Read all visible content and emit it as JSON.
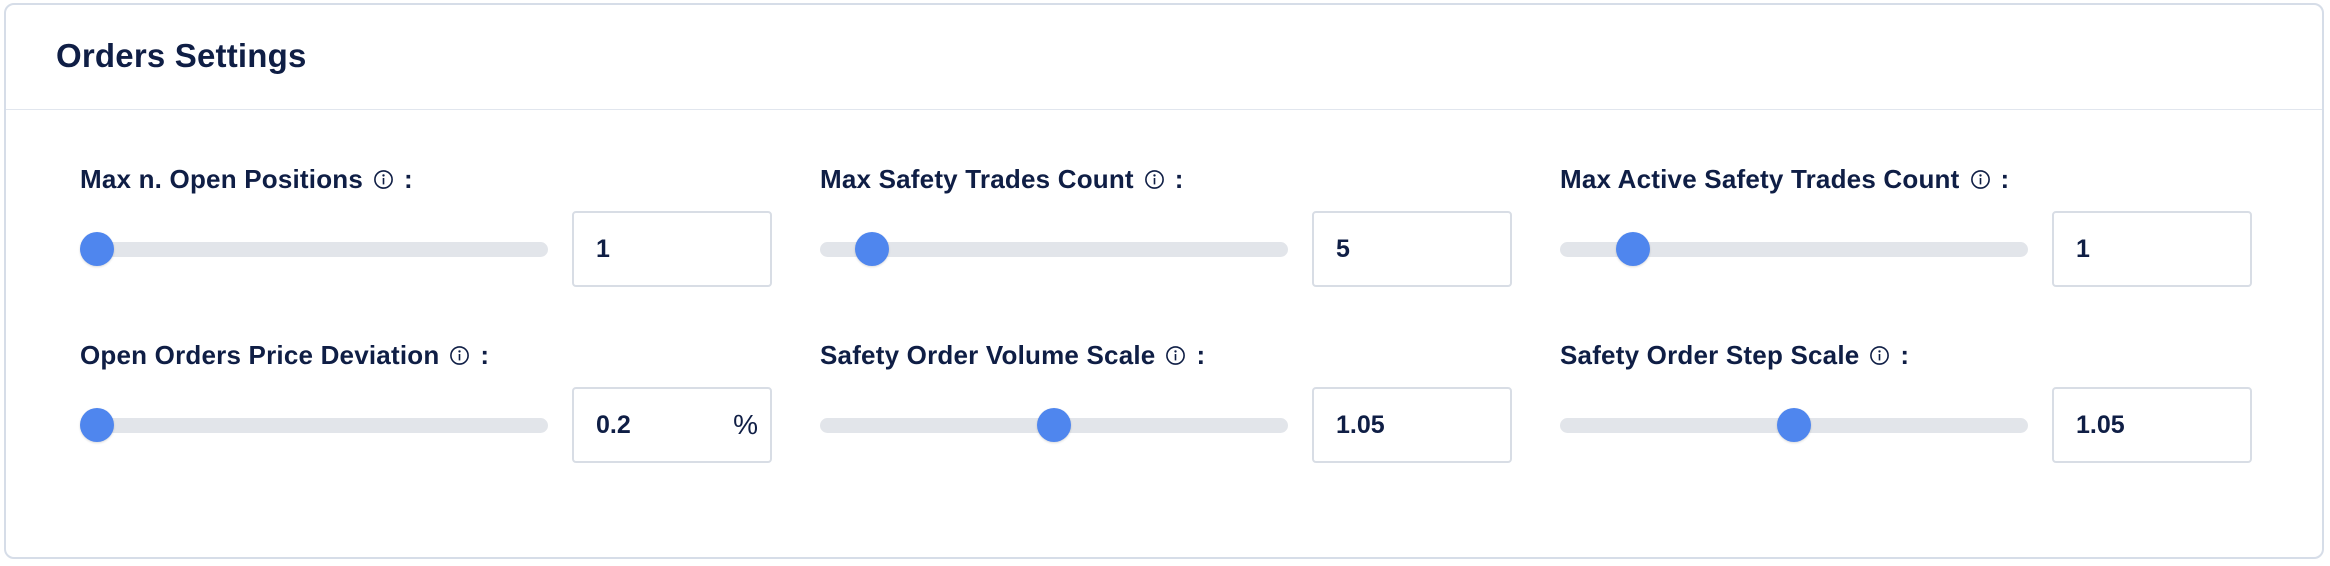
{
  "panel": {
    "title": "Orders Settings"
  },
  "fields": [
    {
      "label": "Max n. Open Positions",
      "value": "1",
      "suffix": "",
      "slider_fraction": 0.0
    },
    {
      "label": "Max Safety Trades Count",
      "value": "5",
      "suffix": "",
      "slider_fraction": 0.08
    },
    {
      "label": "Max Active Safety Trades Count",
      "value": "1",
      "suffix": "",
      "slider_fraction": 0.13
    },
    {
      "label": "Open Orders Price Deviation",
      "value": "0.2",
      "suffix": "%",
      "slider_fraction": 0.0
    },
    {
      "label": "Safety Order Volume Scale",
      "value": "1.05",
      "suffix": "",
      "slider_fraction": 0.5
    },
    {
      "label": "Safety Order Step Scale",
      "value": "1.05",
      "suffix": "",
      "slider_fraction": 0.5
    }
  ],
  "colon": ":",
  "colors": {
    "accent": "#4f86ee",
    "text": "#0f1e45",
    "track": "#e2e5ea",
    "border": "#d6dde8"
  },
  "icons": {
    "info": "info-circle-icon"
  }
}
